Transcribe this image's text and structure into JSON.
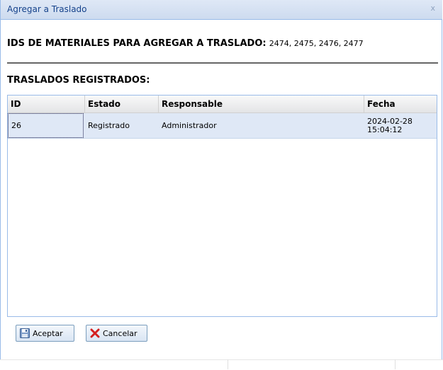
{
  "window": {
    "title": "Agregar a Traslado",
    "close_label": "x"
  },
  "ids_section": {
    "label": "IDS DE MATERIALES PARA AGREGAR A TRASLADO:",
    "value": "2474, 2475, 2476, 2477"
  },
  "registered": {
    "title": "TRASLADOS REGISTRADOS:"
  },
  "grid": {
    "columns": [
      "ID",
      "Estado",
      "Responsable",
      "Fecha"
    ],
    "rows": [
      {
        "id": "26",
        "estado": "Registrado",
        "responsable": "Administrador",
        "fecha_date": "2024-02-28",
        "fecha_time": "15:04:12"
      }
    ]
  },
  "buttons": {
    "accept_label": "Aceptar",
    "cancel_label": "Cancelar"
  },
  "colors": {
    "titlebar": "#cddbef",
    "selected_row": "#dfe8f6",
    "border": "#99bbe8",
    "cancel_icon": "#d42020"
  }
}
